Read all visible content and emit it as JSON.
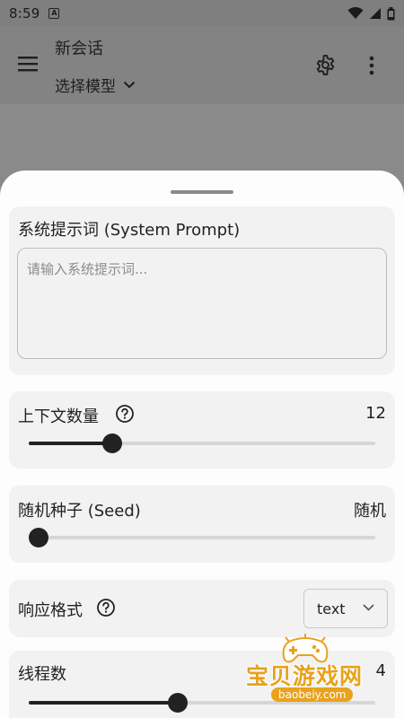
{
  "status_bar": {
    "time": "8:59",
    "notification_icon": "A"
  },
  "app_bar": {
    "title": "新会话",
    "model_selector": "选择模型",
    "icons": [
      "menu-icon",
      "settings-icon",
      "more-vert-icon"
    ]
  },
  "sheet": {
    "system_prompt": {
      "label": "系统提示词 (System Prompt)",
      "placeholder": "请输入系统提示词...",
      "value": ""
    },
    "context_count": {
      "label": "上下文数量",
      "value": "12",
      "slider_fraction": 0.24
    },
    "seed": {
      "label": "随机种子 (Seed)",
      "value": "随机",
      "slider_fraction": 0.0
    },
    "response_format": {
      "label": "响应格式",
      "selected": "text"
    },
    "threads": {
      "label": "线程数",
      "value": "4",
      "slider_fraction": 0.43
    }
  },
  "watermark": {
    "title": "宝贝游戏网",
    "url": "baobeiy.com"
  },
  "colors": {
    "scrim": "#8a8a8a",
    "card": "#f2f2f2",
    "accent": "#222222",
    "watermark": "#e8a21c"
  }
}
